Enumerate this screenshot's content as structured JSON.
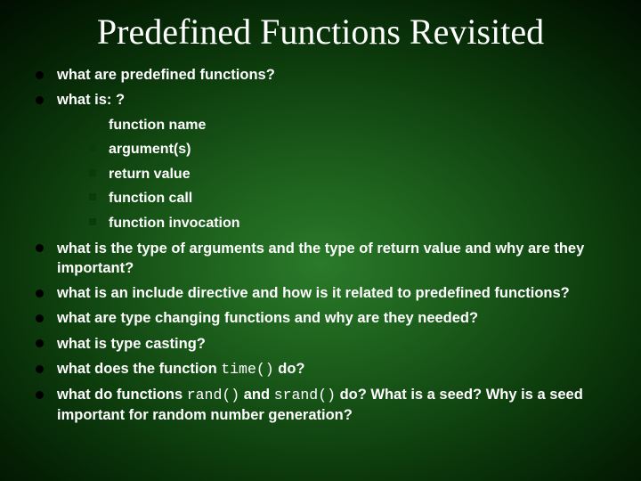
{
  "title": "Predefined Functions Revisited",
  "bullets": {
    "b1": "what are predefined functions?",
    "b2": "what is: ?",
    "b2_sub": {
      "s1": "function name",
      "s2": "argument(s)",
      "s3": "return value",
      "s4": "function call",
      "s5": "function invocation"
    },
    "b3": "what is the type of arguments and the type of return value and why are they important?",
    "b4": "what is an include directive and how is it related to predefined functions?",
    "b5": "what are type changing functions and why are they needed?",
    "b6": "what is type casting?",
    "b7_pre": "what does the function ",
    "b7_code": "time()",
    "b7_post": " do?",
    "b8_pre": "what do functions ",
    "b8_code1": "rand()",
    "b8_mid": " and ",
    "b8_code2": "srand()",
    "b8_post": " do? What is a seed? Why is a seed important for random number generation?"
  }
}
